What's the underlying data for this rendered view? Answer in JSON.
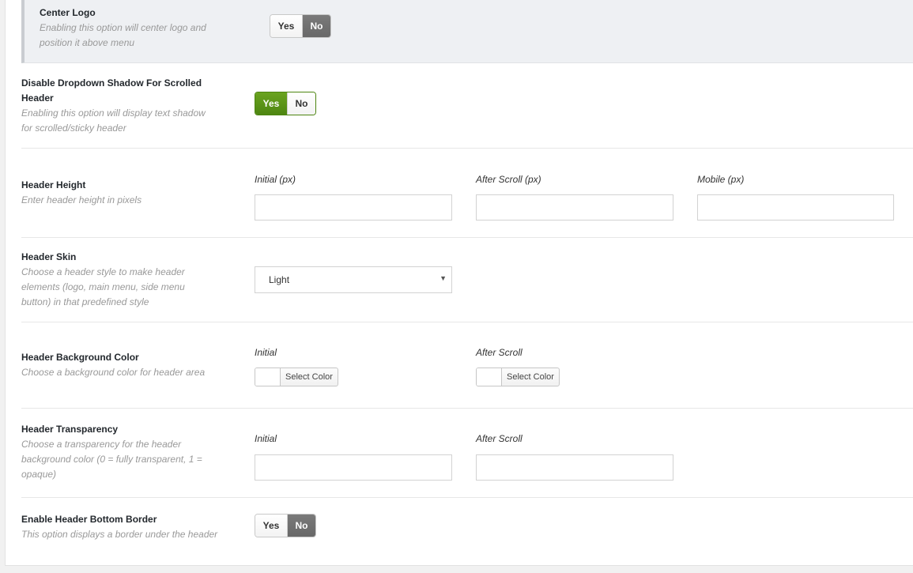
{
  "center_logo": {
    "title": "Center Logo",
    "desc_line1": "Enabling this option will center logo and",
    "desc_line2": "position it above menu",
    "yes": "Yes",
    "no": "No",
    "selected": "No"
  },
  "dropdown_shadow": {
    "title_line1": "Disable Dropdown Shadow For Scrolled",
    "title_line2": "Header",
    "desc_line1": "Enabling this option will display text shadow",
    "desc_line2": "for scrolled/sticky header",
    "yes": "Yes",
    "no": "No",
    "selected": "Yes"
  },
  "header_height": {
    "title": "Header Height",
    "desc": "Enter header height in pixels",
    "initial_label": "Initial (px)",
    "after_scroll_label": "After Scroll (px)",
    "mobile_label": "Mobile (px)",
    "initial_value": "",
    "after_scroll_value": "",
    "mobile_value": ""
  },
  "header_skin": {
    "title": "Header Skin",
    "desc_line1": "Choose a header style to make header",
    "desc_line2": "elements (logo, main menu, side menu",
    "desc_line3": "button) in that predefined style",
    "selected": "Light"
  },
  "header_bg_color": {
    "title": "Header Background Color",
    "desc": "Choose a background color for header area",
    "initial_label": "Initial",
    "after_scroll_label": "After Scroll",
    "button_label": "Select Color"
  },
  "header_transparency": {
    "title": "Header Transparency",
    "desc_line1": "Choose a transparency for the header",
    "desc_line2": "background color (0 = fully transparent, 1 =",
    "desc_line3": "opaque)",
    "initial_label": "Initial",
    "after_scroll_label": "After Scroll",
    "initial_value": "",
    "after_scroll_value": ""
  },
  "bottom_border": {
    "title": "Enable Header Bottom Border",
    "desc": "This option displays a border under the header",
    "yes": "Yes",
    "no": "No",
    "selected": "No"
  },
  "colors": {
    "active_yes": "#5a9417",
    "active_no": "#6f6f6f"
  }
}
